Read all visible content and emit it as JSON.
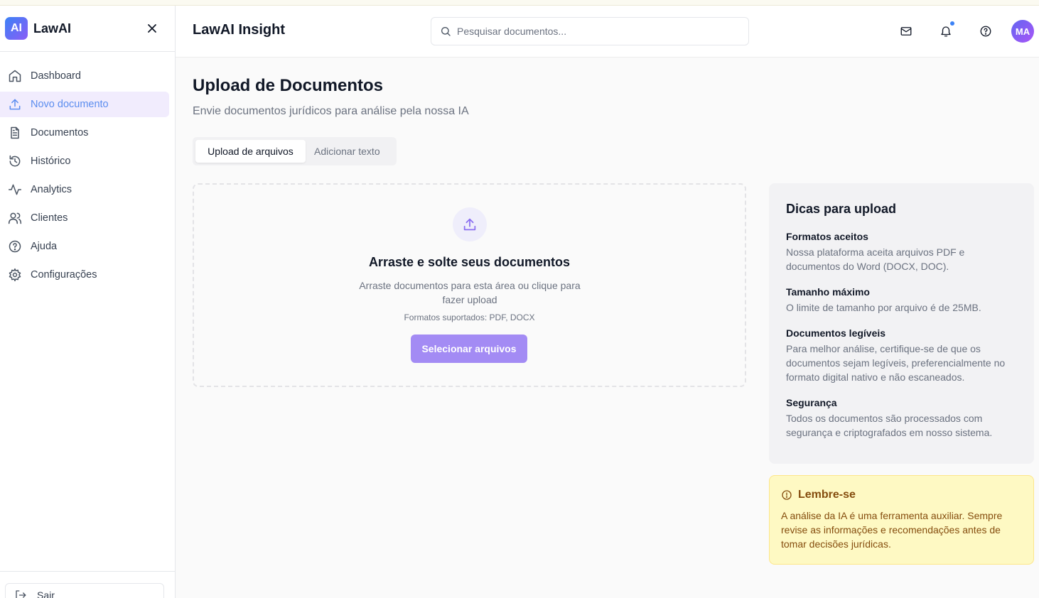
{
  "brand": {
    "logo": "AI",
    "name": "LawAI"
  },
  "sidebar": {
    "items": [
      {
        "label": "Dashboard",
        "icon": "home-icon"
      },
      {
        "label": "Novo documento",
        "icon": "upload-icon",
        "active": true
      },
      {
        "label": "Documentos",
        "icon": "file-text-icon"
      },
      {
        "label": "Histórico",
        "icon": "history-icon"
      },
      {
        "label": "Analytics",
        "icon": "activity-icon"
      },
      {
        "label": "Clientes",
        "icon": "users-icon"
      },
      {
        "label": "Ajuda",
        "icon": "help-circle-icon"
      },
      {
        "label": "Configurações",
        "icon": "settings-icon"
      }
    ],
    "logout_label": "Sair"
  },
  "header": {
    "title": "LawAI Insight",
    "search_placeholder": "Pesquisar documentos...",
    "avatar_initials": "MA"
  },
  "main": {
    "title": "Upload de Documentos",
    "subtitle": "Envie documentos jurídicos para análise pela nossa IA",
    "tabs": [
      {
        "label": "Upload de arquivos",
        "active": true
      },
      {
        "label": "Adicionar texto"
      }
    ],
    "dropzone": {
      "title": "Arraste e solte seus documentos",
      "text": "Arraste documentos para esta área ou clique para fazer upload",
      "formats": "Formatos suportados: PDF, DOCX",
      "button": "Selecionar arquivos"
    }
  },
  "tips": {
    "title": "Dicas para upload",
    "items": [
      {
        "heading": "Formatos aceitos",
        "text": "Nossa plataforma aceita arquivos PDF e documentos do Word (DOCX, DOC)."
      },
      {
        "heading": "Tamanho máximo",
        "text": "O limite de tamanho por arquivo é de 25MB."
      },
      {
        "heading": "Documentos legíveis",
        "text": "Para melhor análise, certifique-se de que os documentos sejam legíveis, preferencialmente no formato digital nativo e não escaneados."
      },
      {
        "heading": "Segurança",
        "text": "Todos os documentos são processados com segurança e criptografados em nosso sistema."
      }
    ]
  },
  "remember": {
    "title": "Lembre-se",
    "text": "A análise da IA é uma ferramenta auxiliar. Sempre revise as informações e recomendações antes de tomar decisões jurídicas."
  },
  "colors": {
    "accent": "#a38bf4",
    "active_nav_bg": "#f1ecfd",
    "active_nav_text": "#5b8def",
    "notice_bg": "#fef9c3",
    "notice_text": "#854d0e"
  }
}
